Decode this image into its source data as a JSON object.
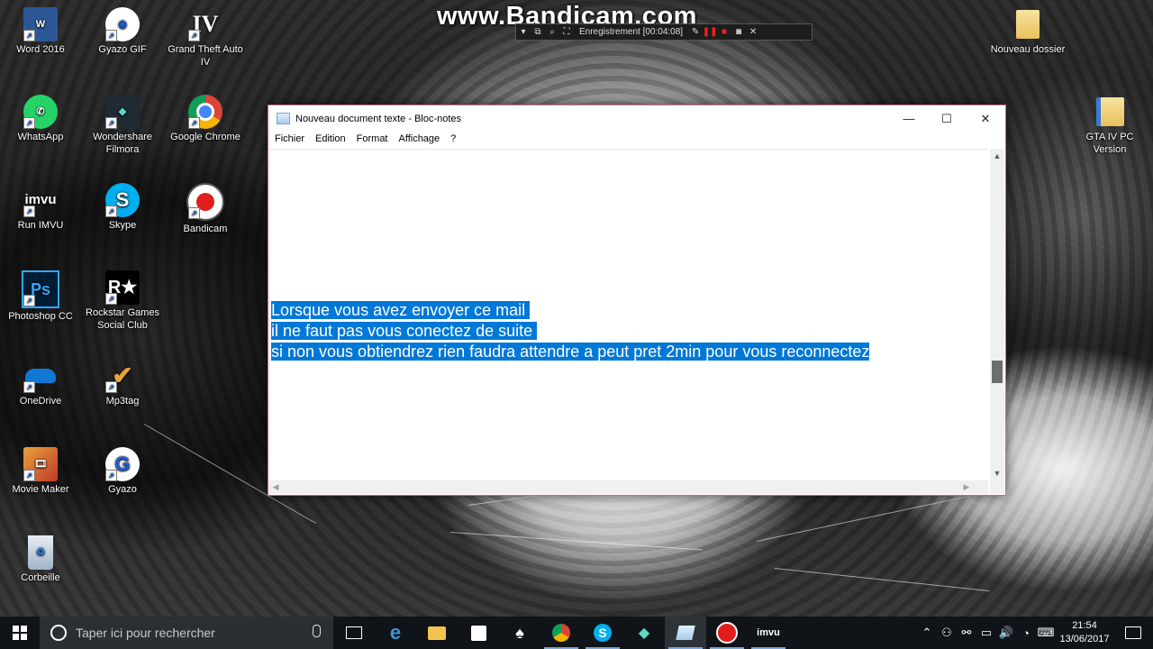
{
  "watermark": {
    "text": "www.Bandicam.com",
    "recording_label": "Enregistrement [00:04:08]"
  },
  "desktop_icons": [
    {
      "label": "Word 2016"
    },
    {
      "label": "Gyazo GIF"
    },
    {
      "label": "Grand Theft Auto IV"
    },
    {
      "label": "WhatsApp"
    },
    {
      "label": "Wondershare Filmora"
    },
    {
      "label": "Google Chrome"
    },
    {
      "label": "Run IMVU"
    },
    {
      "label": "Skype"
    },
    {
      "label": "Bandicam"
    },
    {
      "label": "Photoshop CC"
    },
    {
      "label": "Rockstar Games Social Club"
    },
    {
      "label": "OneDrive"
    },
    {
      "label": "Mp3tag"
    },
    {
      "label": "Movie Maker"
    },
    {
      "label": "Gyazo"
    },
    {
      "label": "Corbeille"
    },
    {
      "label": "Nouveau dossier"
    },
    {
      "label": "GTA IV PC Version"
    }
  ],
  "notepad": {
    "title": "Nouveau document texte - Bloc-notes",
    "menu": [
      "Fichier",
      "Edition",
      "Format",
      "Affichage",
      "?"
    ],
    "lines": [
      "Lorsque vous avez envoyer ce mail ",
      "il ne faut pas vous conectez de suite ",
      "si non vous obtiendrez rien faudra attendre a peut pret 2min pour vous reconnectez"
    ],
    "selection_color": "#0078d7"
  },
  "taskbar": {
    "search_placeholder": "Taper ici pour rechercher",
    "pinned": [
      "task-view",
      "edge",
      "file-explorer",
      "store",
      "solitaire",
      "chrome",
      "skype",
      "filmora",
      "notepad",
      "bandicam",
      "imvu"
    ],
    "time": "21:54",
    "date": "13/06/2017"
  }
}
